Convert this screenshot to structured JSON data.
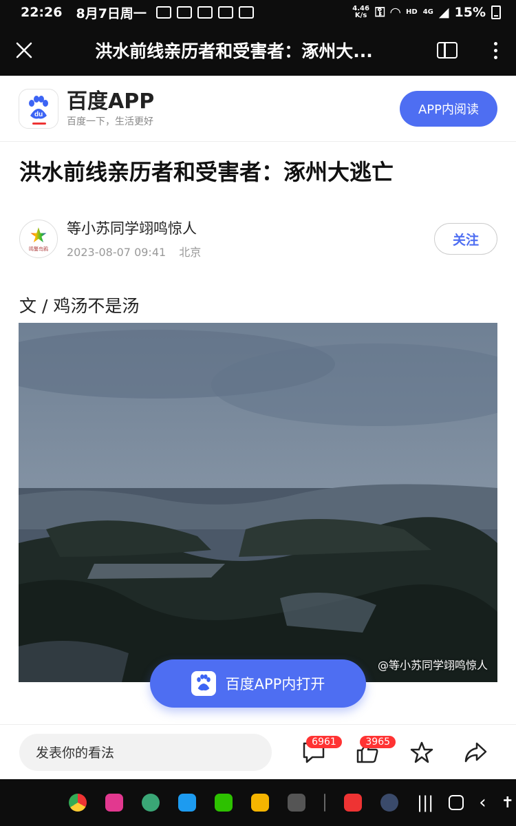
{
  "status_bar": {
    "time": "22:26",
    "date": "8月7日周一",
    "net_speed_top": "4.46",
    "net_speed_bottom": "K/s",
    "signal": "HD",
    "network": "4G",
    "battery": "15%"
  },
  "header": {
    "title": "洪水前线亲历者和受害者：涿州大..."
  },
  "app_banner": {
    "name": "百度APP",
    "slogan": "百度一下，生活更好",
    "open_button": "APP内阅读"
  },
  "article": {
    "title": "洪水前线亲历者和受害者：涿州大逃亡",
    "author": "等小苏同学翊鸣惊人",
    "avatar_caption": "鸣警鸟鸦",
    "timestamp": "2023-08-07 09:41",
    "location": "北京",
    "follow_label": "关注",
    "byline": "文 / 鸡汤不是汤",
    "image_watermark": "@等小苏同学翊鸣惊人"
  },
  "floating_button": {
    "label": "百度APP内打开"
  },
  "bottom_bar": {
    "comment_placeholder": "发表你的看法",
    "comment_count": "6961",
    "like_count": "3965"
  },
  "dock": {
    "apps": [
      "chrome-icon",
      "flower-icon",
      "compass-icon",
      "twitter-icon",
      "wechat-icon",
      "folder-icon",
      "grid-icon",
      "notes-icon",
      "settings-icon"
    ]
  },
  "colors": {
    "accent": "#4e6ef2",
    "badge": "#ff3333"
  }
}
